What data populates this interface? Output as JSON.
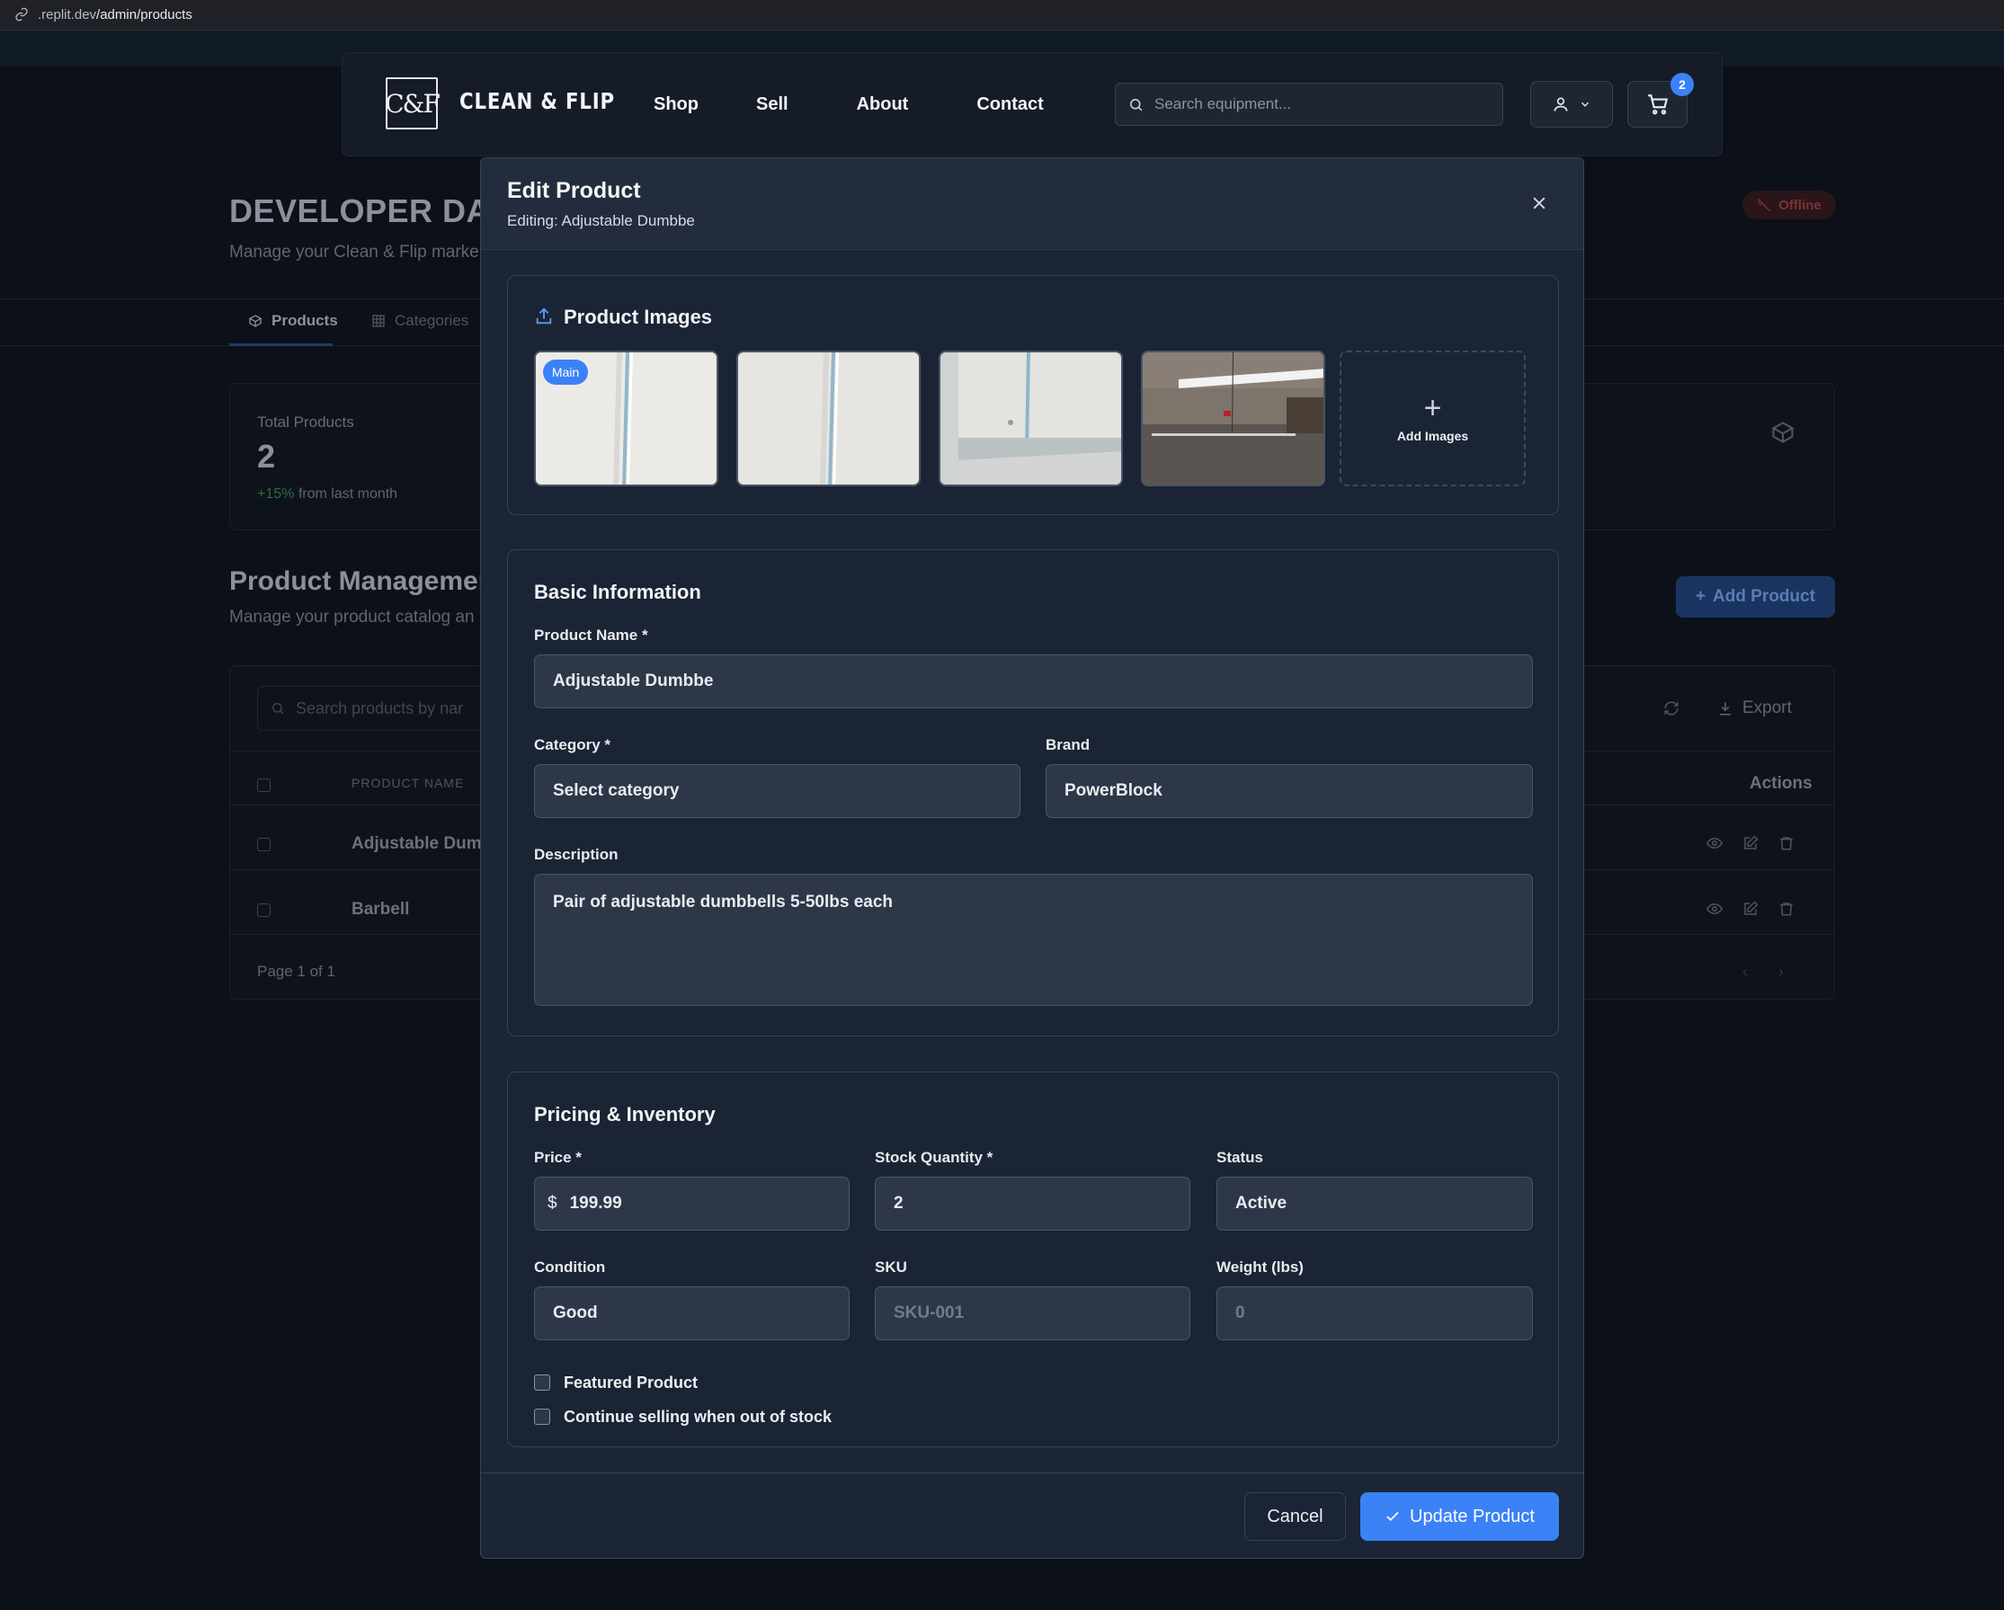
{
  "browser": {
    "url_prefix": ".replit.dev",
    "url_path": "/admin/products"
  },
  "header": {
    "logo_mark": "C&F",
    "logo_text": "CLEAN & FLIP",
    "nav": [
      "Shop",
      "Sell",
      "About",
      "Contact"
    ],
    "search_placeholder": "Search equipment...",
    "cart_count": "2"
  },
  "dashboard": {
    "title": "DEVELOPER DAS",
    "subtitle": "Manage your Clean & Flip marke",
    "offline_label": "Offline",
    "tabs": [
      "Products",
      "Categories"
    ],
    "stat": {
      "label": "Total Products",
      "value": "2",
      "change_pos": "+15%",
      "change_rest": " from last month"
    },
    "pm_title": "Product Managemen",
    "pm_subtitle": "Manage your product catalog an",
    "add_product": "Add Product",
    "table_search_placeholder": "Search products by nar",
    "export_label": "Export",
    "col_product_name": "PRODUCT NAME",
    "col_actions": "Actions",
    "rows": [
      "Adjustable Duml",
      "Barbell"
    ],
    "page_text": "Page 1 of 1"
  },
  "modal": {
    "title": "Edit Product",
    "subtitle": "Editing: Adjustable Dumbbe",
    "images_title": "Product Images",
    "main_badge": "Main",
    "add_images": "Add Images",
    "basic_title": "Basic Information",
    "product_name_label": "Product Name *",
    "product_name_value": "Adjustable Dumbbe",
    "category_label": "Category *",
    "category_value": "Select category",
    "brand_label": "Brand",
    "brand_value": "PowerBlock",
    "description_label": "Description",
    "description_value": "Pair of adjustable dumbbells 5-50lbs each",
    "pricing_title": "Pricing & Inventory",
    "price_label": "Price *",
    "price_prefix": "$",
    "price_value": "199.99",
    "stock_label": "Stock Quantity *",
    "stock_value": "2",
    "status_label": "Status",
    "status_value": "Active",
    "condition_label": "Condition",
    "condition_value": "Good",
    "sku_label": "SKU",
    "sku_placeholder": "SKU-001",
    "weight_label": "Weight (lbs)",
    "weight_placeholder": "0",
    "featured_label": "Featured Product",
    "continue_label": "Continue selling when out of stock",
    "cancel": "Cancel",
    "update": "Update Product"
  },
  "colors": {
    "accent": "#3b82f6",
    "panel": "#1c2535",
    "field": "#2d3748"
  }
}
